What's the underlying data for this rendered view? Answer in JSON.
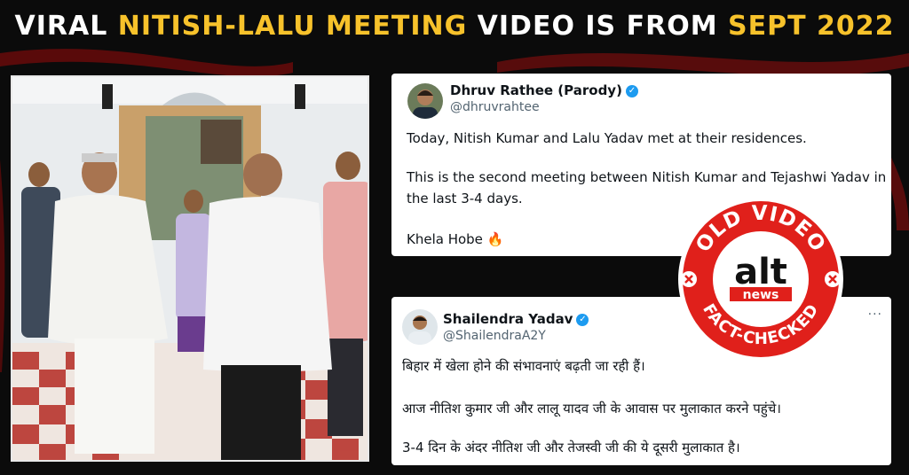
{
  "headline": {
    "part1": "VIRAL ",
    "part2": "NITISH-LALU MEETING",
    "part3": " VIDEO IS FROM ",
    "part4": "SEPT 2022"
  },
  "tweet1": {
    "name": "Dhruv Rathee (Parody)",
    "handle": "@dhruvrahtee",
    "line1": "Today, Nitish Kumar and Lalu Yadav met at their residences.",
    "line2": "This is the second meeting between Nitish Kumar and Tejashwi Yadav in",
    "line3": "the last 3-4 days.",
    "line4": "Khela Hobe 🔥"
  },
  "tweet2": {
    "name": "Shailendra Yadav",
    "handle": "@ShailendraA2Y",
    "more": "···",
    "line1": "बिहार में खेला होने की संभावनाएं बढ़ती जा रही हैं।",
    "line2": "आज नीतिश कुमार जी और लालू यादव जी के आवास पर मुलाकात करने पहुंचे।",
    "line3": "3-4 दिन के अंदर नीतिश जी और तेजस्वी जी की ये दूसरी मुलाकात है।"
  },
  "stamp": {
    "top_text": "OLD VIDEO",
    "bottom_text": "FACT-CHECKED",
    "logo_alt": "alt",
    "logo_news": "news"
  },
  "colors": {
    "accent_yellow": "#f7c22b",
    "stamp_red": "#e0201b",
    "twitter_blue": "#1d9bf0",
    "background": "#0b0b0b"
  }
}
